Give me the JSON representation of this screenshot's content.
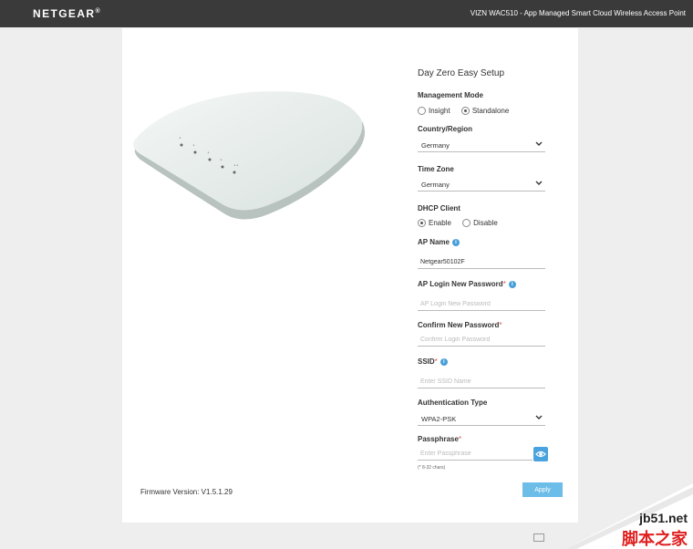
{
  "header": {
    "logo": "NETGEAR",
    "logo_mark": "®",
    "product": "VIZN WAC510 - App Managed Smart Cloud Wireless Access Point"
  },
  "firmware": "Firmware Version: V1.5.1.29",
  "form": {
    "title": "Day Zero Easy Setup",
    "management_mode": {
      "label": "Management Mode",
      "options": [
        "Insight",
        "Standalone"
      ],
      "selected": "Standalone"
    },
    "country": {
      "label": "Country/Region",
      "value": "Germany"
    },
    "timezone": {
      "label": "Time Zone",
      "value": "Germany"
    },
    "dhcp": {
      "label": "DHCP Client",
      "options": [
        "Enable",
        "Disable"
      ],
      "selected": "Enable"
    },
    "ap_name": {
      "label": "AP Name",
      "value": "Netgear50102F"
    },
    "ap_password": {
      "label": "AP Login New Password",
      "required": "*",
      "placeholder": "AP Login New Password"
    },
    "confirm_password": {
      "label": "Confirm New Password",
      "required": "*",
      "placeholder": "Confirm Login Password"
    },
    "ssid": {
      "label": "SSID",
      "required": "*",
      "placeholder": "Enter SSID Name"
    },
    "auth_type": {
      "label": "Authentication Type",
      "value": "WPA2-PSK"
    },
    "passphrase": {
      "label": "Passphrase",
      "required": "*",
      "placeholder": "Enter Passphrase",
      "hint": "(* 8-32 chars)"
    },
    "apply_label": "Apply"
  },
  "watermark": {
    "line1": "jb51.net",
    "line2": "脚本之家"
  },
  "colors": {
    "topbar": "#3a3a3a",
    "accent": "#4aa3df",
    "apply": "#6cbde8",
    "info": "#4a9fd8"
  },
  "icons": [
    "info-icon",
    "chevron-down-icon",
    "eye-icon",
    "keyboard-icon"
  ]
}
